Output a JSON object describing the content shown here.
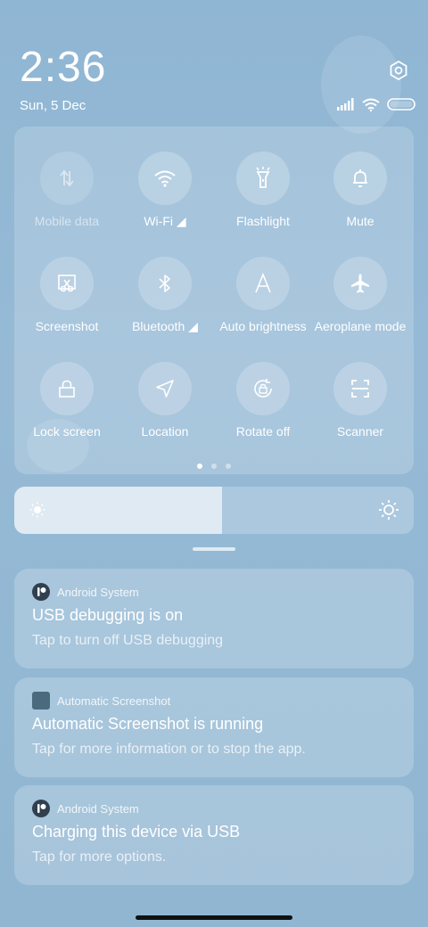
{
  "status": {
    "time": "2:36",
    "date": "Sun, 5 Dec"
  },
  "tiles": [
    {
      "label": "Mobile data",
      "icon": "mobile-data-icon",
      "enabled": false
    },
    {
      "label": "Wi-Fi ◢",
      "icon": "wifi-icon",
      "enabled": true
    },
    {
      "label": "Flashlight",
      "icon": "flashlight-icon",
      "enabled": true
    },
    {
      "label": "Mute",
      "icon": "bell-icon",
      "enabled": true
    },
    {
      "label": "Screenshot",
      "icon": "screenshot-icon",
      "enabled": true
    },
    {
      "label": "Bluetooth ◢",
      "icon": "bluetooth-icon",
      "enabled": true
    },
    {
      "label": "Auto brightness",
      "icon": "auto-brightness-icon",
      "enabled": true
    },
    {
      "label": "Aeroplane mode",
      "icon": "airplane-icon",
      "enabled": true
    },
    {
      "label": "Lock screen",
      "icon": "lock-icon",
      "enabled": true
    },
    {
      "label": "Location",
      "icon": "location-icon",
      "enabled": true
    },
    {
      "label": "Rotate off",
      "icon": "rotate-lock-icon",
      "enabled": true
    },
    {
      "label": "Scanner",
      "icon": "scanner-icon",
      "enabled": true
    }
  ],
  "pager": {
    "pages": 3,
    "active": 0
  },
  "brightness": {
    "level": 0.52
  },
  "notifications": [
    {
      "app": "Android System",
      "title": "USB debugging is on",
      "text": "Tap to turn off USB debugging"
    },
    {
      "app": "Automatic Screenshot",
      "title": "Automatic Screenshot is running",
      "text": "Tap for more information or to stop the app."
    },
    {
      "app": "Android System",
      "title": "Charging this device via USB",
      "text": "Tap for more options."
    }
  ],
  "colors": {
    "background": "#93b8d4",
    "accent": "#ffffff"
  }
}
